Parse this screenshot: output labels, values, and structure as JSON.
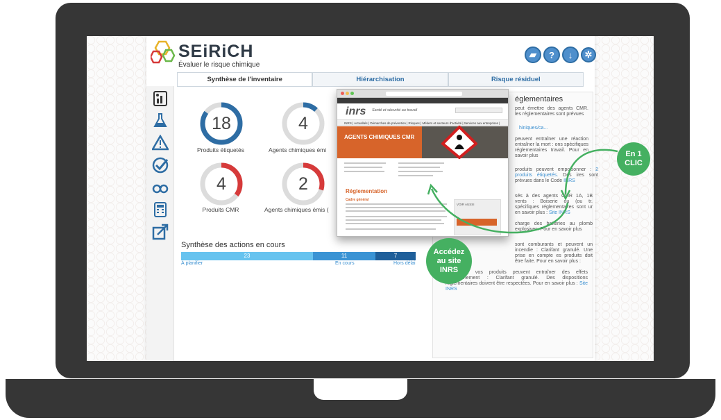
{
  "app": {
    "name": "SEiRiCH",
    "tagline": "Évaluer le risque chimique"
  },
  "toolbar": [
    {
      "name": "open-folder-button",
      "glyph": "▰"
    },
    {
      "name": "help-button",
      "glyph": "?"
    },
    {
      "name": "download-button",
      "glyph": "↓"
    },
    {
      "name": "settings-button",
      "glyph": "✲"
    }
  ],
  "tabs": [
    {
      "label": "Synthèse de l'inventaire",
      "active": true
    },
    {
      "label": "Hiérarchisation",
      "active": false
    },
    {
      "label": "Risque résiduel",
      "active": false
    }
  ],
  "sidebar_icons": [
    "inventory-icon",
    "flask-icon",
    "warning-icon",
    "checkmark-icon",
    "binoculars-icon",
    "calculator-icon",
    "export-icon"
  ],
  "gauges": [
    {
      "value": "18",
      "label": "Produits étiquetés",
      "fill": 0.85,
      "color": "#2e6da4"
    },
    {
      "value": "4",
      "label": "Agents chimiques émi",
      "fill": 0.12,
      "color": "#2e6da4"
    },
    {
      "value": "4",
      "label": "Produits CMR",
      "fill": 0.35,
      "color": "#d63a3a"
    },
    {
      "value": "2",
      "label": "Agents chimiques émis (",
      "fill": 0.3,
      "color": "#d63a3a"
    }
  ],
  "actions": {
    "title": "Synthèse des actions en cours",
    "segments": [
      {
        "value": "23",
        "label": "À planifier",
        "color": "#67c3ef"
      },
      {
        "value": "11",
        "label": "En cours",
        "color": "#3a93d4"
      },
      {
        "value": "7",
        "label": "Hors délai",
        "color": "#1f5f9a"
      }
    ]
  },
  "right_panel": {
    "title": "églementaires",
    "p1": "peut émettre des agents CMR. les réglementaires sont prévues",
    "link1": "hiniques/ca...",
    "p2": "peuvent entraîner une réaction entraîner la mort : ons spécifiques réglementaires travail. Pour en savoir plus",
    "p3": "produits peuvent empoisonner :",
    "link3": "2 produits étiquetés.",
    "p3b": "Des ires sont prévues dans le Code",
    "link3b": "INRS",
    "p4": "sés à des agents CMR 1A, 1B vents : Boiserie ou (ou tr. spécifiques réglementaires sont ur en savoir plus :",
    "link4": "Site INRS",
    "p5": "charge des batteries au plomb explosives. Pour en savoir plus",
    "p6": "sont comburants et peuvent un incendie : Clarifant granulé. Une prise en compte es produits doit être faite. Pour en savoir plus :",
    "p7": "rtains de vos produits peuvent entraîner des effets l'environnement : Clarifant granulé. Des dispositions réglementaires doivent être respectées. Pour en savoir plus :",
    "link7": "Site INRS"
  },
  "popup": {
    "logo": "inrs",
    "tagline": "Santé et sécurité au travail",
    "nav": "INRS | Actualités | Démarches de prévention | Risques | Métiers et secteurs d'activité | Services aux entreprises | Publications et outils",
    "banner_title": "AGENTS CHIMIQUES CMR",
    "section_title": "Réglementation",
    "section_sub": "Cadre général",
    "voir_aussi": "VOIR AUSSI"
  },
  "callouts": {
    "clic_line1": "En 1",
    "clic_line2": "CLIC",
    "inrs_line1": "Accédez",
    "inrs_line2": "au site",
    "inrs_line3": "INRS"
  }
}
